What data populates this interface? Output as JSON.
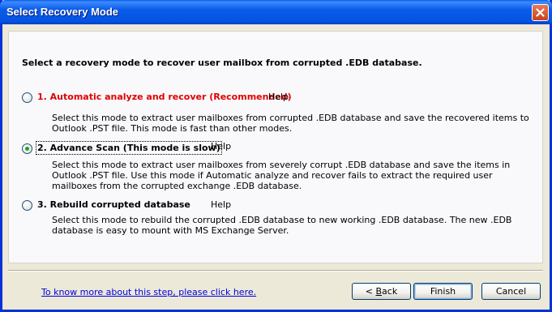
{
  "window": {
    "title": "Select Recovery Mode"
  },
  "intro": "Select a recovery mode to recover user mailbox from corrupted .EDB database.",
  "options": [
    {
      "label": "1. Automatic analyze and recover (Recommended)",
      "help": "Help",
      "selected": false,
      "desc": "Select this mode to extract user mailboxes from corrupted .EDB database and save the recovered items to Outlook .PST file. This mode is fast than other modes."
    },
    {
      "label": "2. Advance Scan (This mode is slow)",
      "help": "Help",
      "selected": true,
      "desc": "Select this mode to extract user mailboxes from severely corrupt .EDB database and save the items in Outlook .PST file. Use this mode if Automatic analyze and recover fails to extract the required user mailboxes from the corrupted exchange .EDB database."
    },
    {
      "label": "3. Rebuild corrupted database",
      "help": "Help",
      "selected": false,
      "desc": "Select this mode to rebuild the corrupted .EDB database to new working .EDB database. The new .EDB database is easy to mount with MS Exchange Server."
    }
  ],
  "footer": {
    "link": "To know more about this step, please click here.",
    "back_prefix": "< ",
    "back_accel": "B",
    "back_rest": "ack",
    "finish": "Finish",
    "cancel": "Cancel"
  },
  "colors": {
    "titlebar": "#0a5ce8",
    "recommended": "#e00000",
    "link": "#0000e0"
  },
  "icons": {
    "close": "close-icon"
  }
}
